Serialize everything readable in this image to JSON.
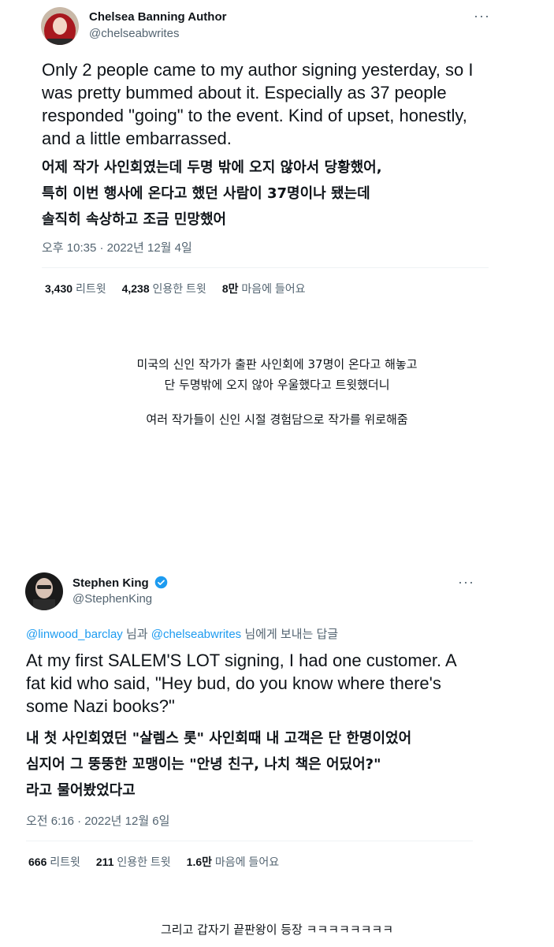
{
  "tweet1": {
    "author_name": "Chelsea Banning Author",
    "author_handle": "@chelseabwrites",
    "body_en": "Only 2 people came to my author signing yesterday, so I was pretty bummed about it. Especially as 37 people responded \"going\" to the event. Kind of upset, honestly, and a little embarrassed.",
    "body_ko": [
      "어제 작가 사인회였는데 두명 밖에 오지 않아서 당황했어,",
      "특히 이번 행사에 온다고 했던 사람이 37명이나 됐는데",
      "솔직히 속상하고 조금 민망했어"
    ],
    "timestamp": "오후 10:35 · 2022년 12월 4일",
    "stats": [
      {
        "count": "3,430",
        "label": "리트윗"
      },
      {
        "count": "4,238",
        "label": "인용한 트윗"
      },
      {
        "count": "8만",
        "label": "마음에 들어요"
      }
    ]
  },
  "caption1": [
    "미국의 신인 작가가 출판 사인회에 37명이 온다고 해놓고",
    "단 두명밖에 오지 않아 우울했다고 트윗했더니"
  ],
  "caption2": "여러 작가들이 신인 시절 경험담으로 작가를 위로해줌",
  "tweet2": {
    "author_name": "Stephen King",
    "author_handle": "@StephenKing",
    "reply_mention1": "@linwood_barclay",
    "reply_and": " 님과 ",
    "reply_mention2": "@chelseabwrites",
    "reply_suffix": " 님에게 보내는 답글",
    "body_en": "At my first SALEM'S LOT signing, I had one customer. A fat kid who said, \"Hey bud, do you know where there's some Nazi books?\"",
    "body_ko": [
      "내 첫 사인회였던 \"살렘스 롯\" 사인회때 내 고객은 단 한명이었어",
      "심지어 그 뚱뚱한 꼬맹이는 \"안녕 친구, 나치 책은 어딨어?\"",
      "라고 물어봤었다고"
    ],
    "timestamp": "오전 6:16 · 2022년 12월 6일",
    "stats": [
      {
        "count": "666",
        "label": "리트윗"
      },
      {
        "count": "211",
        "label": "인용한 트윗"
      },
      {
        "count": "1.6만",
        "label": "마음에 들어요"
      }
    ]
  },
  "caption3": "그리고 갑자기 끝판왕이 등장 ㅋㅋㅋㅋㅋㅋㅋㅋ",
  "colors": {
    "link": "#1d9bf0",
    "verified": "#1d9bf0",
    "secondary_text": "#536471"
  },
  "icons": {
    "more": "more-horizontal-icon",
    "verified": "verified-badge-icon"
  }
}
